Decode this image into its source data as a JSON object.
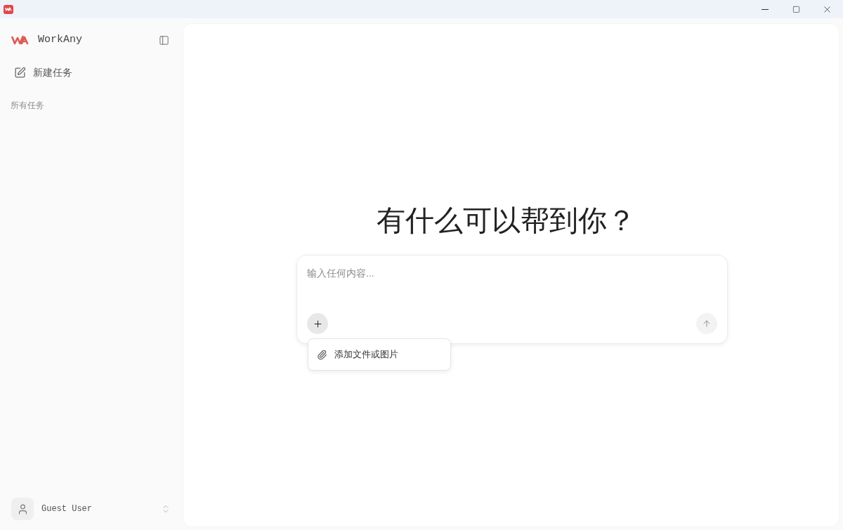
{
  "sidebar": {
    "brand": "WorkAny",
    "new_task": "新建任务",
    "section_label": "所有任务",
    "user": {
      "name": "Guest User"
    }
  },
  "main": {
    "heading": "有什么可以帮到你？",
    "composer": {
      "placeholder": "输入任何内容...",
      "add_button": {
        "expanded": true
      },
      "send_button": {
        "disabled": true
      },
      "menu": {
        "items": [
          {
            "label": "添加文件或图片"
          }
        ]
      }
    }
  }
}
